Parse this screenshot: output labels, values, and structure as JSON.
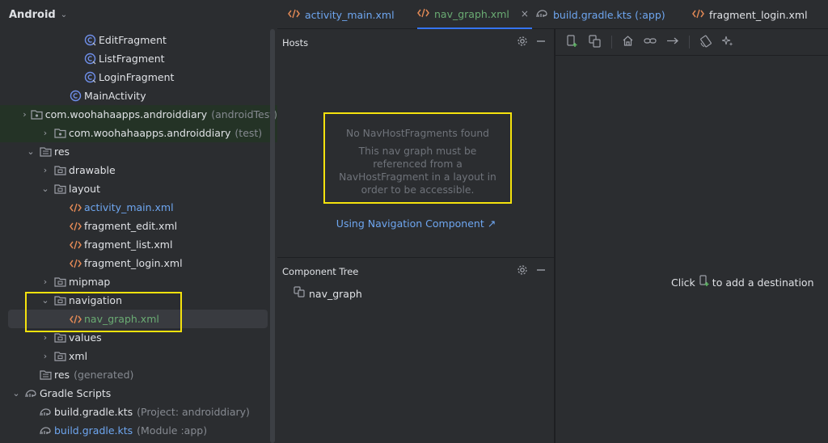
{
  "project": {
    "title": "Android",
    "tree": [
      {
        "indent": 103,
        "arrow": "",
        "icon": "class-icon",
        "label": "EditFragment",
        "style": "",
        "sub": ""
      },
      {
        "indent": 103,
        "arrow": "",
        "icon": "class-icon",
        "label": "ListFragment",
        "style": "",
        "sub": ""
      },
      {
        "indent": 103,
        "arrow": "",
        "icon": "class-icon",
        "label": "LoginFragment",
        "style": "",
        "sub": ""
      },
      {
        "indent": 85,
        "arrow": "",
        "icon": "activity-icon",
        "label": "MainActivity",
        "style": "",
        "sub": ""
      },
      {
        "indent": 66,
        "arrow": "›",
        "icon": "package-icon",
        "label": "com.woohahaapps.androiddiary",
        "style": "",
        "sub": "(androidTest)",
        "bg": "test"
      },
      {
        "indent": 66,
        "arrow": "›",
        "icon": "package-icon",
        "label": "com.woohahaapps.androiddiary",
        "style": "",
        "sub": "(test)",
        "bg": "test"
      },
      {
        "indent": 48,
        "arrow": "⌄",
        "icon": "res-folder-icon",
        "label": "res",
        "style": "",
        "sub": ""
      },
      {
        "indent": 66,
        "arrow": "›",
        "icon": "folder-icon",
        "label": "drawable",
        "style": "",
        "sub": ""
      },
      {
        "indent": 66,
        "arrow": "⌄",
        "icon": "folder-icon",
        "label": "layout",
        "style": "",
        "sub": ""
      },
      {
        "indent": 85,
        "arrow": "",
        "icon": "xml-icon",
        "label": "activity_main.xml",
        "style": "blue",
        "sub": ""
      },
      {
        "indent": 85,
        "arrow": "",
        "icon": "xml-icon",
        "label": "fragment_edit.xml",
        "style": "",
        "sub": ""
      },
      {
        "indent": 85,
        "arrow": "",
        "icon": "xml-icon",
        "label": "fragment_list.xml",
        "style": "",
        "sub": ""
      },
      {
        "indent": 85,
        "arrow": "",
        "icon": "xml-icon",
        "label": "fragment_login.xml",
        "style": "",
        "sub": ""
      },
      {
        "indent": 66,
        "arrow": "›",
        "icon": "folder-icon",
        "label": "mipmap",
        "style": "",
        "sub": ""
      },
      {
        "indent": 66,
        "arrow": "⌄",
        "icon": "folder-icon",
        "label": "navigation",
        "style": "",
        "sub": ""
      },
      {
        "indent": 85,
        "arrow": "",
        "icon": "xml-icon",
        "label": "nav_graph.xml",
        "style": "green",
        "sub": "",
        "selected": true
      },
      {
        "indent": 66,
        "arrow": "›",
        "icon": "folder-icon",
        "label": "values",
        "style": "",
        "sub": ""
      },
      {
        "indent": 66,
        "arrow": "›",
        "icon": "folder-icon",
        "label": "xml",
        "style": "",
        "sub": ""
      },
      {
        "indent": 48,
        "arrow": "",
        "icon": "res-folder-icon",
        "label": "res",
        "style": "",
        "sub": "(generated)"
      },
      {
        "indent": 30,
        "arrow": "⌄",
        "icon": "gradle-icon",
        "label": "Gradle Scripts",
        "style": "",
        "sub": ""
      },
      {
        "indent": 48,
        "arrow": "",
        "icon": "gradle-file-icon",
        "label": "build.gradle.kts",
        "style": "",
        "sub": "(Project: androiddiary)"
      },
      {
        "indent": 48,
        "arrow": "",
        "icon": "gradle-file-icon",
        "label": "build.gradle.kts",
        "style": "blue",
        "sub": "(Module :app)"
      }
    ]
  },
  "tabs": [
    {
      "label": "activity_main.xml",
      "icon": "xml-icon",
      "style": "blue",
      "active": false
    },
    {
      "label": "nav_graph.xml",
      "icon": "xml-icon",
      "style": "green",
      "active": true,
      "close": "×"
    },
    {
      "label": "build.gradle.kts (:app)",
      "icon": "gradle-file-icon",
      "style": "blue",
      "active": false
    },
    {
      "label": "fragment_login.xml",
      "icon": "xml-icon",
      "style": "",
      "active": false
    }
  ],
  "hosts": {
    "title": "Hosts",
    "empty_title": "No NavHostFragments found",
    "empty_lines": [
      "This nav graph must be",
      "referenced from a",
      "NavHostFragment in a layout in",
      "order to be accessible."
    ],
    "link": "Using Navigation Component ↗"
  },
  "component_tree": {
    "title": "Component Tree",
    "root": "nav_graph"
  },
  "design": {
    "hint_before": "Click",
    "hint_after": "to add a destination"
  },
  "colors": {
    "highlight": "#f5e20d",
    "link": "#6ea6f0",
    "accent": "#3574f0"
  }
}
